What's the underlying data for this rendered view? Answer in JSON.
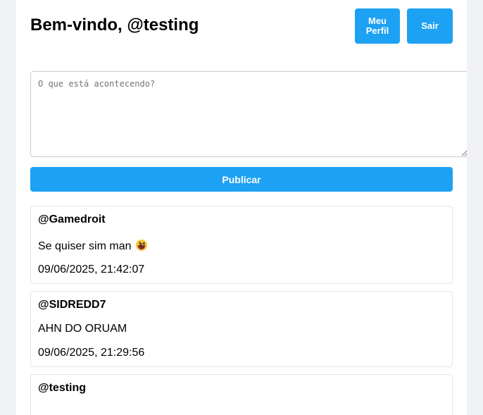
{
  "header": {
    "welcome": "Bem-vindo, @testing",
    "profile_button": "Meu Perfil",
    "logout_button": "Sair"
  },
  "composer": {
    "placeholder": "O que está acontecendo?",
    "value": "",
    "publish_button": "Publicar"
  },
  "posts": [
    {
      "author": "@Gamedroit",
      "text": "Se quiser sim man",
      "emoji": "grinning-squinting-face",
      "time": "09/06/2025, 21:42:07"
    },
    {
      "author": "@SIDREDD7",
      "text": "AHN DO ORUAM",
      "time": "09/06/2025, 21:29:56"
    },
    {
      "author": "@testing",
      "text": "",
      "time": ""
    }
  ],
  "colors": {
    "accent": "#1da1f2",
    "page_background": "#f0f2f5",
    "card_border": "#e1e4e8"
  }
}
